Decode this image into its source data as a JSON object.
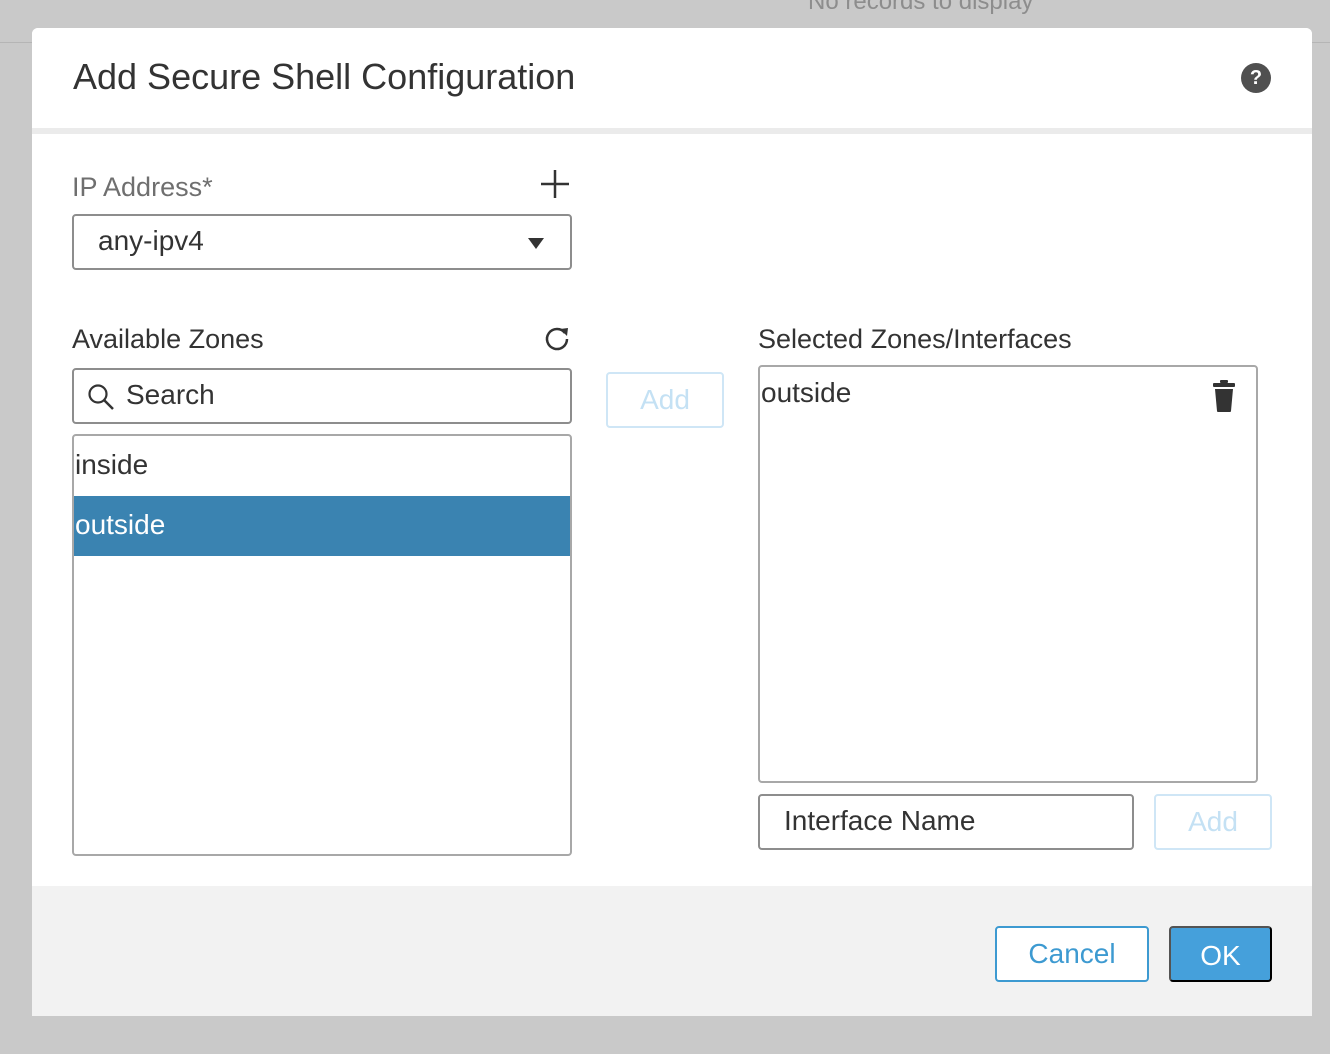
{
  "background": {
    "empty_text": "No records to display"
  },
  "dialog": {
    "title": "Add Secure Shell Configuration",
    "help_icon": "help-icon"
  },
  "ip_address": {
    "label": "IP Address*",
    "add_icon": "plus-icon",
    "selected_value": "any-ipv4"
  },
  "available_zones": {
    "label": "Available Zones",
    "refresh_icon": "refresh-icon",
    "search_placeholder": "Search",
    "items": [
      {
        "label": "inside",
        "selected": false
      },
      {
        "label": "outside",
        "selected": true
      }
    ]
  },
  "add_button_label": "Add",
  "selected_zones": {
    "label": "Selected Zones/Interfaces",
    "items": [
      {
        "label": "outside"
      }
    ],
    "delete_icon": "trash-icon"
  },
  "interface": {
    "placeholder": "Interface Name",
    "add_label": "Add"
  },
  "footer": {
    "cancel_label": "Cancel",
    "ok_label": "OK"
  },
  "colors": {
    "accent": "#45a0db",
    "selected_row": "#3a83b1",
    "disabled_button_text": "#c4e1f4"
  }
}
